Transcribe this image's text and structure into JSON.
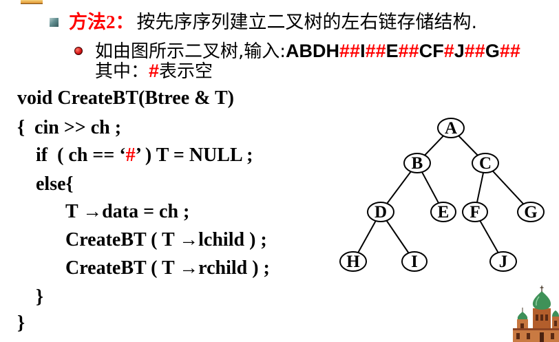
{
  "colors": {
    "accent": "#ff0000",
    "text": "#000000"
  },
  "heading": {
    "label": "方法2：",
    "text": "按先序序列建立二叉树的左右链存储结构."
  },
  "example": {
    "prefix": "如由图所示二叉树,输入:",
    "sequence": [
      "ABDH",
      "##",
      "I",
      "##",
      "E",
      "##",
      "CF",
      "#",
      "J",
      "##",
      "G",
      "##"
    ]
  },
  "note": {
    "prefix": "其中：",
    "symbol": "#",
    "suffix": "表示空"
  },
  "code": {
    "signature": "void CreateBT(Btree & T)",
    "open_read": "{  cin >> ch ;",
    "if_head": "if  ( ch == ‘",
    "if_symbol": "#",
    "if_tail": "’ ) T = NULL ;",
    "else_open": "else{",
    "assign_data": "T →data = ch ;",
    "call_left": "CreateBT ( T →lchild ) ;",
    "call_right": "CreateBT ( T →rchild ) ;",
    "else_close": "}",
    "function_close": "}"
  },
  "tree": {
    "nodes": [
      "A",
      "B",
      "C",
      "D",
      "E",
      "F",
      "G",
      "H",
      "I",
      "J"
    ],
    "edges": [
      [
        0,
        1
      ],
      [
        0,
        2
      ],
      [
        1,
        3
      ],
      [
        1,
        4
      ],
      [
        2,
        5
      ],
      [
        2,
        6
      ],
      [
        3,
        7
      ],
      [
        3,
        8
      ],
      [
        5,
        9
      ]
    ]
  }
}
